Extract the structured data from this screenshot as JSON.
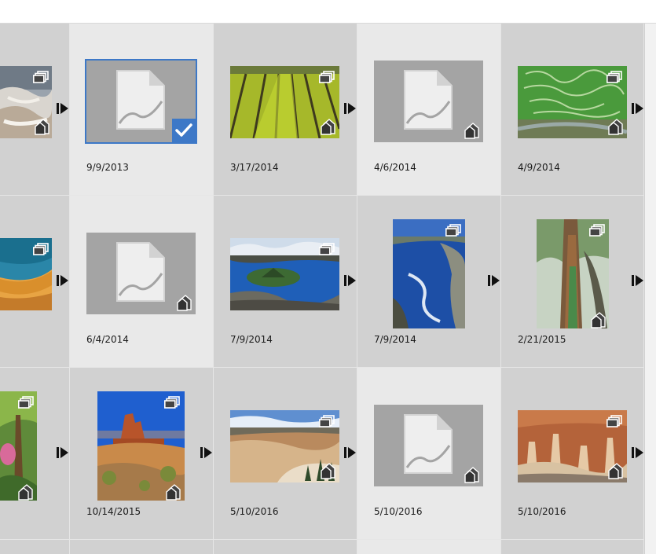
{
  "colors": {
    "selection": "#3d78c7",
    "cell_light": "#e9e9e9",
    "cell_dark": "#d1d1d1",
    "placeholder": "#a4a4a4"
  },
  "icons": {
    "stack": "stack-icon",
    "house": "stack-badge-icon",
    "arrow": "expand-stack-arrow-icon",
    "placeholder": "missing-file-icon",
    "check": "checkmark-icon"
  },
  "rows": [
    {
      "cells": [
        {
          "date": "",
          "image": "hot-springs-terraces"
        },
        {
          "date": "9/9/2013",
          "image": "missing",
          "selected": true
        },
        {
          "date": "3/17/2014",
          "image": "vineyard-rows"
        },
        {
          "date": "4/6/2014",
          "image": "missing"
        },
        {
          "date": "4/9/2014",
          "image": "aerial-farmland"
        }
      ]
    },
    {
      "cells": [
        {
          "date": "",
          "image": "prismatic-spring"
        },
        {
          "date": "6/4/2014",
          "image": "missing"
        },
        {
          "date": "7/9/2014",
          "image": "crater-lake-island"
        },
        {
          "date": "7/9/2014",
          "image": "crater-lake-shore"
        },
        {
          "date": "2/21/2015",
          "image": "rainbow-eucalyptus"
        }
      ]
    },
    {
      "cells": [
        {
          "date": "",
          "image": "tropical-palms"
        },
        {
          "date": "10/14/2015",
          "image": "desert-rock-formation"
        },
        {
          "date": "5/10/2016",
          "image": "canyon-overlook"
        },
        {
          "date": "5/10/2016",
          "image": "missing"
        },
        {
          "date": "5/10/2016",
          "image": "hoodoo-canyon"
        }
      ]
    }
  ]
}
